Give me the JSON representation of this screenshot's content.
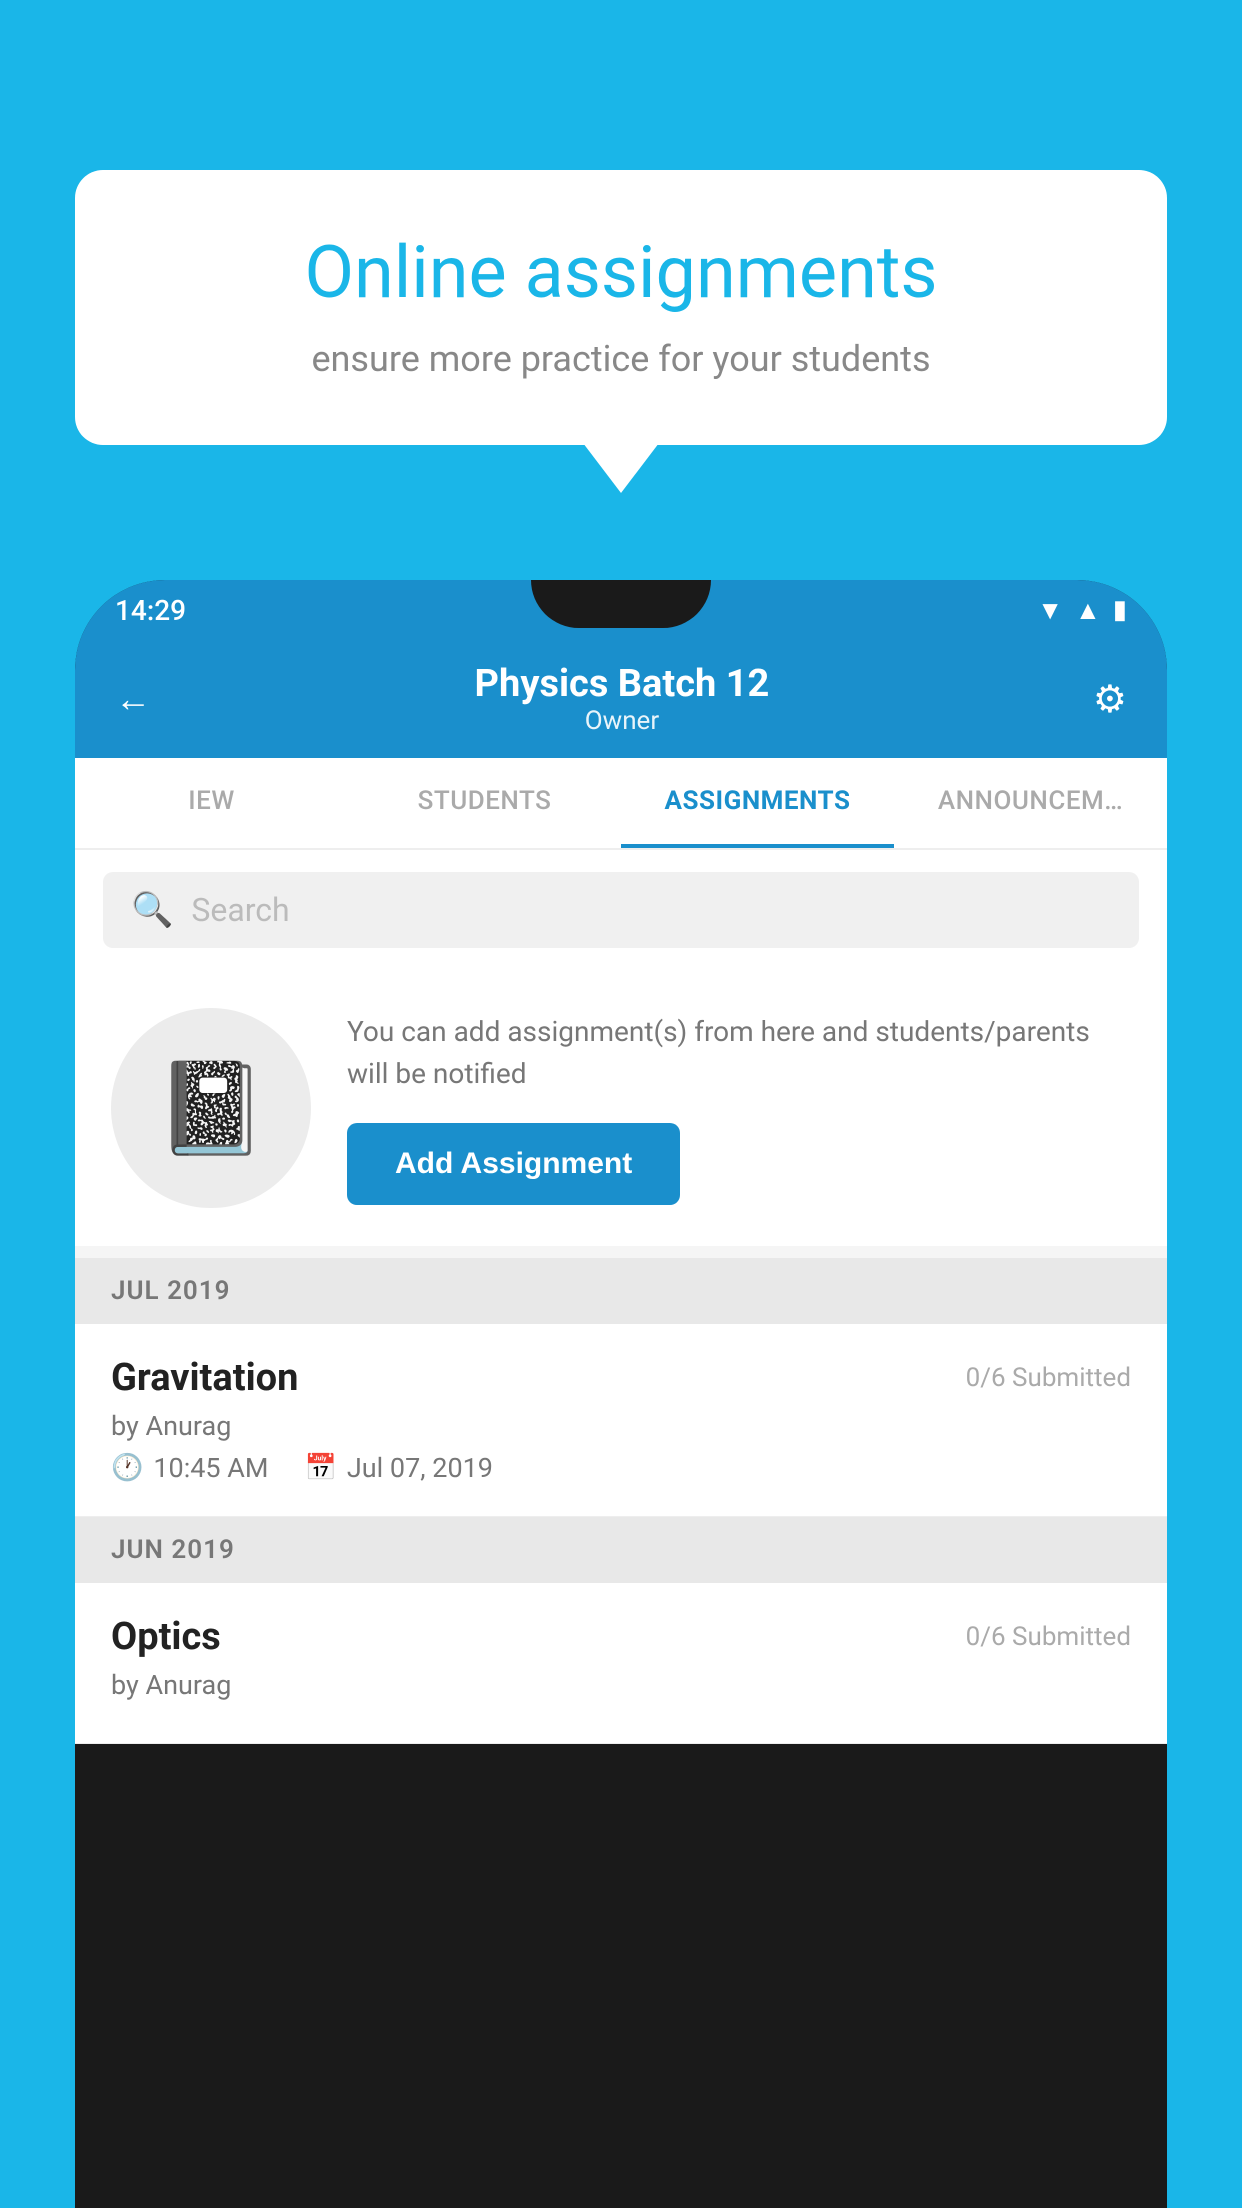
{
  "background_color": "#1ab6e8",
  "speech_bubble": {
    "title": "Online assignments",
    "subtitle": "ensure more practice for your students"
  },
  "status_bar": {
    "time": "14:29",
    "icons": [
      "▼",
      "▲",
      "▮"
    ]
  },
  "app_header": {
    "title": "Physics Batch 12",
    "subtitle": "Owner",
    "back_label": "←",
    "settings_label": "⚙"
  },
  "tabs": [
    {
      "label": "IEW",
      "active": false
    },
    {
      "label": "STUDENTS",
      "active": false
    },
    {
      "label": "ASSIGNMENTS",
      "active": true
    },
    {
      "label": "ANNOUNCEM…",
      "active": false
    }
  ],
  "search": {
    "placeholder": "Search"
  },
  "promo": {
    "description": "You can add assignment(s) from here and students/parents will be notified",
    "button_label": "Add Assignment"
  },
  "sections": [
    {
      "month": "JUL 2019",
      "assignments": [
        {
          "name": "Gravitation",
          "submitted": "0/6 Submitted",
          "by": "by Anurag",
          "time": "10:45 AM",
          "date": "Jul 07, 2019"
        }
      ]
    },
    {
      "month": "JUN 2019",
      "assignments": [
        {
          "name": "Optics",
          "submitted": "0/6 Submitted",
          "by": "by Anurag",
          "time": "",
          "date": ""
        }
      ]
    }
  ]
}
